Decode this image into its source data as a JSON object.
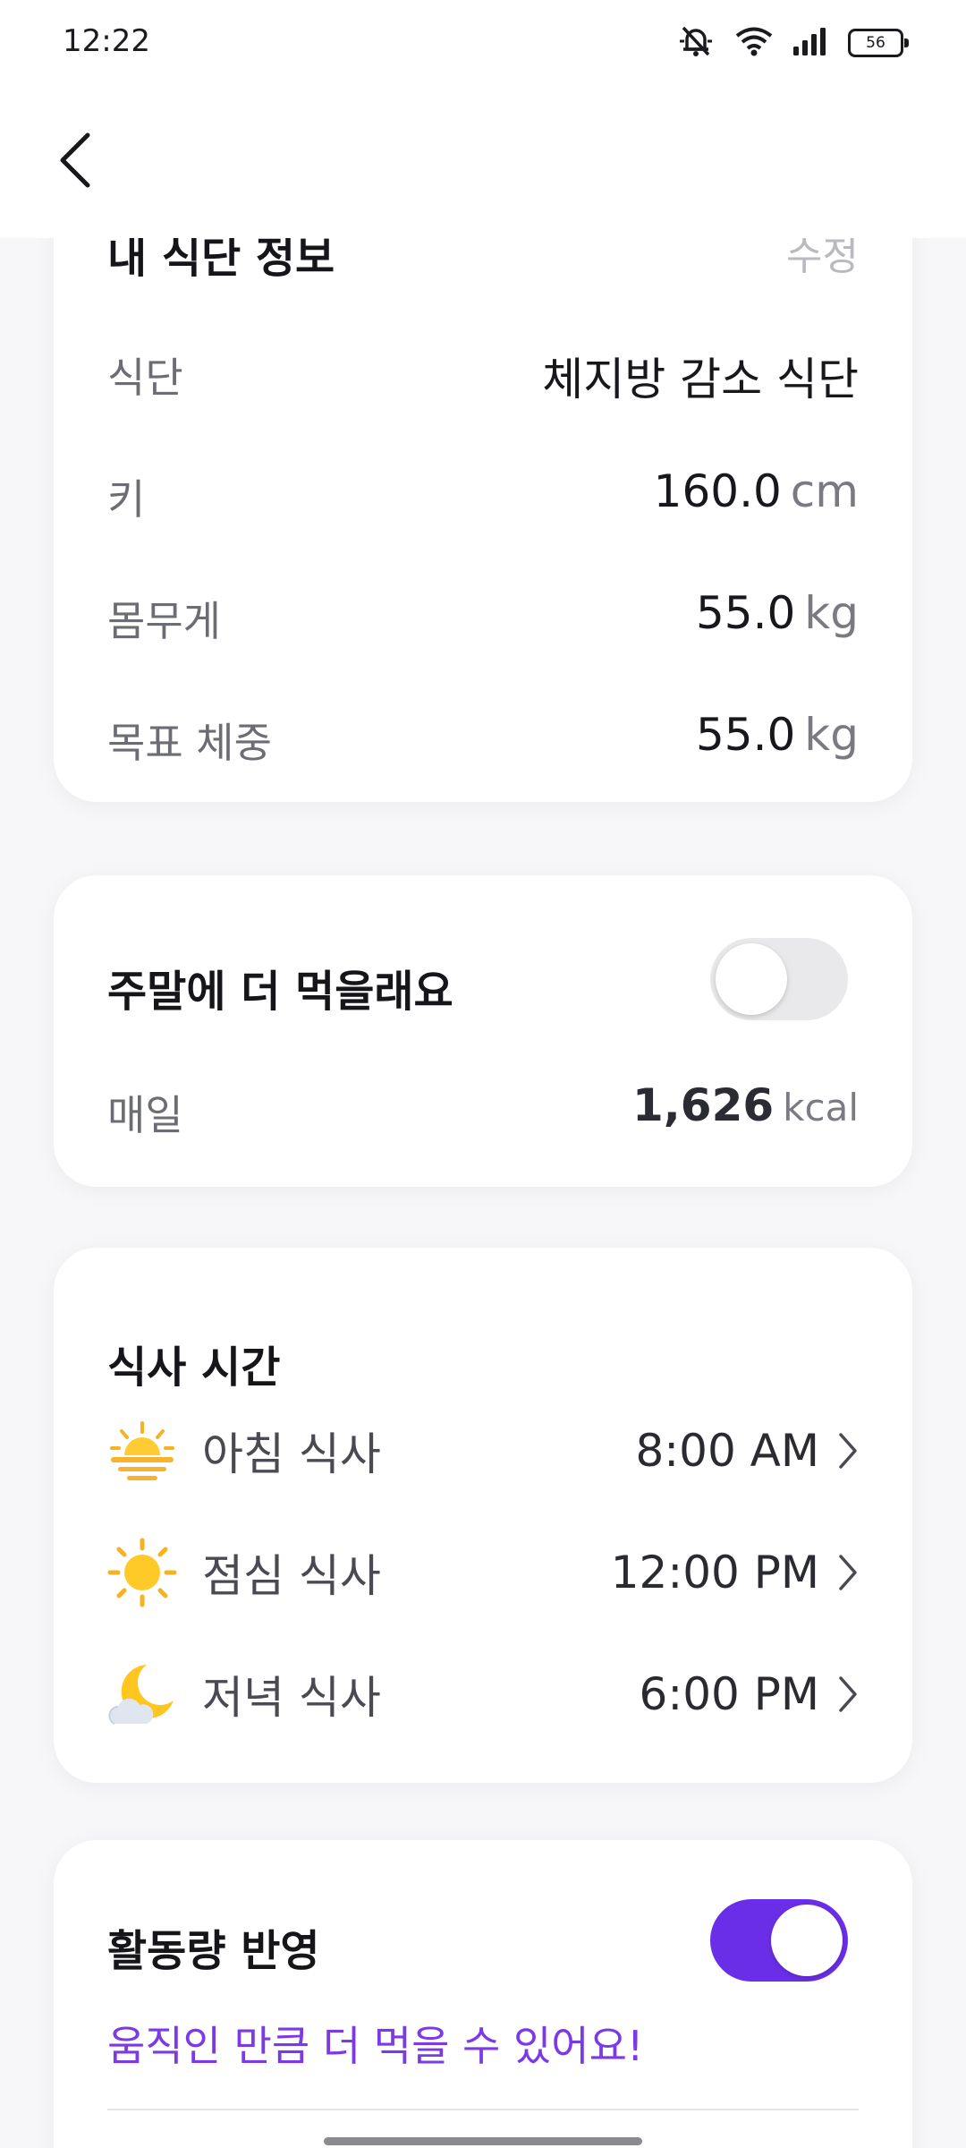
{
  "status_bar": {
    "time": "12:22",
    "battery": "56",
    "icons": [
      "mute-icon",
      "wifi-icon",
      "signal-icon",
      "battery-icon"
    ]
  },
  "diet_info": {
    "title": "내 식단 정보",
    "edit_label": "수정",
    "rows": [
      {
        "label": "식단",
        "value": "체지방 감소 식단",
        "unit": ""
      },
      {
        "label": "키",
        "value": "160.0",
        "unit": "cm"
      },
      {
        "label": "몸무게",
        "value": "55.0",
        "unit": "kg"
      },
      {
        "label": "목표 체중",
        "value": "55.0",
        "unit": "kg"
      }
    ]
  },
  "weekend": {
    "title": "주말에 더 먹을래요",
    "toggle_on": false,
    "daily_label": "매일",
    "daily_value": "1,626",
    "daily_unit": "kcal"
  },
  "meal_times": {
    "title": "식사 시간",
    "items": [
      {
        "icon": "sunrise-icon",
        "label": "아침 식사",
        "time": "8:00 AM"
      },
      {
        "icon": "sun-icon",
        "label": "점심 식사",
        "time": "12:00 PM"
      },
      {
        "icon": "moon-cloud-icon",
        "label": "저녁 식사",
        "time": "6:00 PM"
      }
    ]
  },
  "activity": {
    "title": "활동량 반영",
    "toggle_on": true,
    "subtitle": "움직인 만큼 더 먹을 수 있어요!"
  },
  "colors": {
    "accent": "#6b2ee8",
    "accent_text": "#7c3ae6",
    "muted": "#6c6c74"
  }
}
